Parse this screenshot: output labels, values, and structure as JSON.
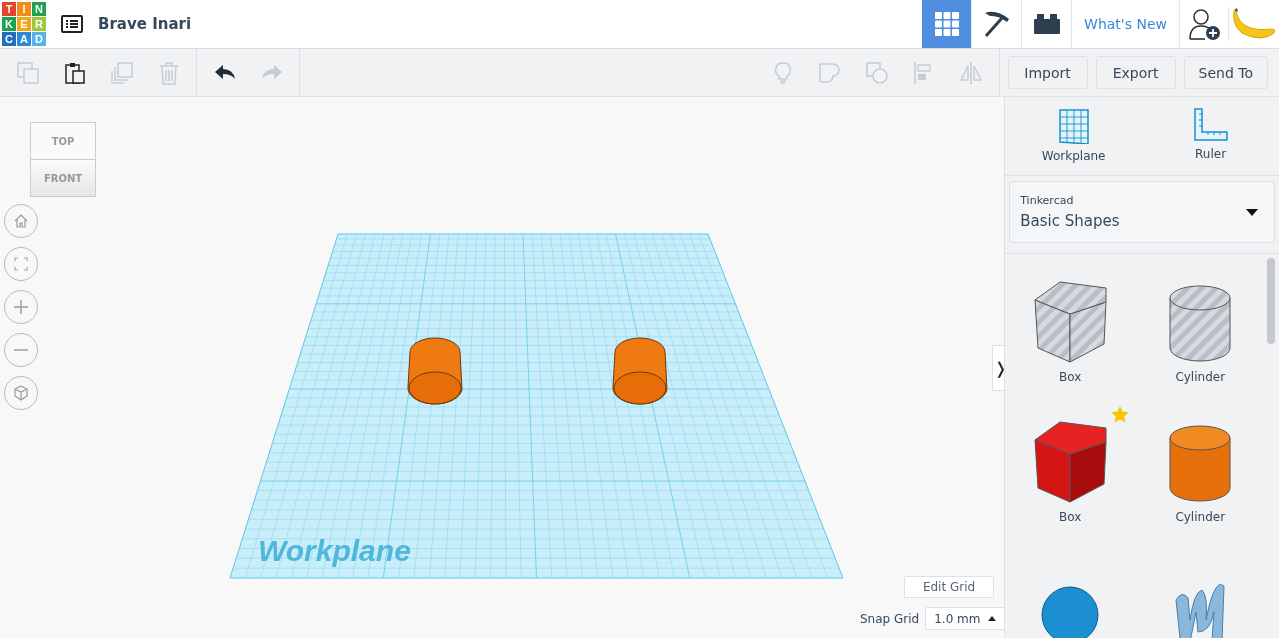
{
  "logo": [
    "T",
    "I",
    "N",
    "K",
    "E",
    "R",
    "C",
    "A",
    "D"
  ],
  "design_title": "Brave Inari",
  "view_modes": [
    {
      "kind": "grid",
      "selected": true
    },
    {
      "kind": "pickaxe",
      "selected": false
    },
    {
      "kind": "brick",
      "selected": false
    }
  ],
  "whats_new": "What's New",
  "toolbar": {
    "edit_tools": [
      {
        "kind": "copy",
        "disabled": true
      },
      {
        "kind": "paste",
        "disabled": false
      },
      {
        "kind": "duplicate",
        "disabled": true
      },
      {
        "kind": "delete",
        "disabled": true
      }
    ],
    "history_tools": [
      {
        "kind": "undo",
        "disabled": false
      },
      {
        "kind": "redo",
        "disabled": true
      }
    ],
    "shape_tools": [
      {
        "kind": "bulb",
        "disabled": true
      },
      {
        "kind": "group",
        "disabled": true
      },
      {
        "kind": "ungroup",
        "disabled": true
      },
      {
        "kind": "align",
        "disabled": true
      },
      {
        "kind": "mirror",
        "disabled": true
      }
    ],
    "buttons": [
      "Import",
      "Export",
      "Send To"
    ]
  },
  "view_cube": {
    "top": "TOP",
    "front": "FRONT"
  },
  "nav_buttons": [
    {
      "kind": "home"
    },
    {
      "kind": "fit"
    },
    {
      "kind": "zoom-in"
    },
    {
      "kind": "zoom-out"
    },
    {
      "kind": "perspective"
    }
  ],
  "workplane_label": "Workplane",
  "edit_grid": "Edit Grid",
  "snap_grid": {
    "label": "Snap Grid",
    "value": "1.0 mm"
  },
  "panel_toggle": "❭",
  "sidebar": {
    "tools": [
      {
        "kind": "workplane",
        "label": "Workplane"
      },
      {
        "kind": "ruler",
        "label": "Ruler"
      }
    ],
    "library": {
      "caption": "Tinkercad",
      "value": "Basic Shapes"
    },
    "shapes": [
      {
        "kind": "box-hole",
        "label": "Box",
        "starred": false
      },
      {
        "kind": "cylinder-hole",
        "label": "Cylinder",
        "starred": false
      },
      {
        "kind": "box",
        "label": "Box",
        "starred": true
      },
      {
        "kind": "cylinder",
        "label": "Cylinder",
        "starred": false
      },
      {
        "kind": "sphere",
        "starred": false
      },
      {
        "kind": "scribble",
        "starred": false
      }
    ]
  }
}
